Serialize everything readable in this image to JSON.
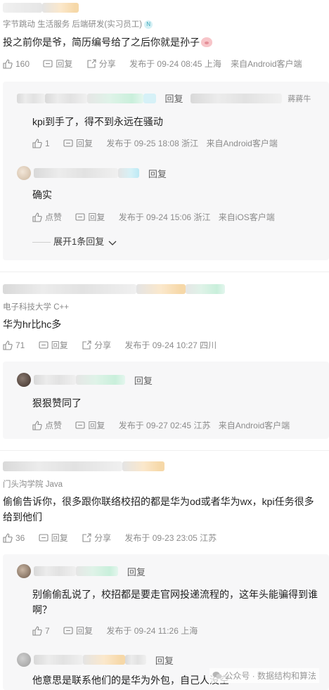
{
  "comments": [
    {
      "tagline": [
        "字节跳动",
        "生活服务",
        "后端研发(实习员工)"
      ],
      "badge": "N",
      "text": "投之前你是爷，简历编号给了之后你就是孙子",
      "likes": "160",
      "reply_label": "回复",
      "share_label": "分享",
      "published": "发布于 09-24 08:45 上海",
      "source": "来自Android客户端",
      "replies": [
        {
          "reply_label": "回复",
          "reply_to": "蔣蔣牛",
          "text": "kpi到手了，得不到永远在骚动",
          "likes": "1",
          "action_reply": "回复",
          "published": "发布于 09-25 18:08 浙江",
          "source": "来自Android客户端"
        },
        {
          "reply_label": "回复",
          "text": "确实",
          "likes": "点赞",
          "action_reply": "回复",
          "published": "发布于 09-24 15:06 浙江",
          "source": "来自iOS客户端"
        }
      ],
      "expand_label": "展开1条回复"
    },
    {
      "tagline": [
        "电子科技大学 C++"
      ],
      "text": "华为hr比hc多",
      "likes": "71",
      "reply_label": "回复",
      "share_label": "分享",
      "published": "发布于 09-24 10:27 四川",
      "replies": [
        {
          "reply_label": "回复",
          "text": "狠狠赞同了",
          "likes": "点赞",
          "action_reply": "回复",
          "published": "发布于 09-27 02:45 江苏",
          "source": "来自Android客户端"
        }
      ]
    },
    {
      "tagline": [
        "门头沟学院 Java"
      ],
      "text": "偷偷告诉你，很多跟你联络校招的都是华为od或者华为wx，kpi任务很多给到他们",
      "likes": "36",
      "reply_label": "回复",
      "share_label": "分享",
      "published": "发布于 09-23 23:05 江苏",
      "replies": [
        {
          "reply_label": "回复",
          "text": "别偷偷乱说了，校招都是要走官网投递流程的，这年头能骗得到谁啊？",
          "likes": "7",
          "action_reply": "回复",
          "published": "发布于 09-24 11:26 上海"
        },
        {
          "reply_label": "回复",
          "text": "他意思是联系他们的是华为外包，自己人没空"
        }
      ]
    }
  ],
  "watermark": "公众号 · 数据结构和算法",
  "icons": {
    "like": "thumbs-up-icon",
    "reply": "chat-bubble-icon",
    "share": "share-icon",
    "expand": "chevron-down-icon"
  },
  "colors": {
    "text": "#1f1f1f",
    "meta": "#8c8c8c",
    "reply_bg": "#f7f7f8"
  }
}
